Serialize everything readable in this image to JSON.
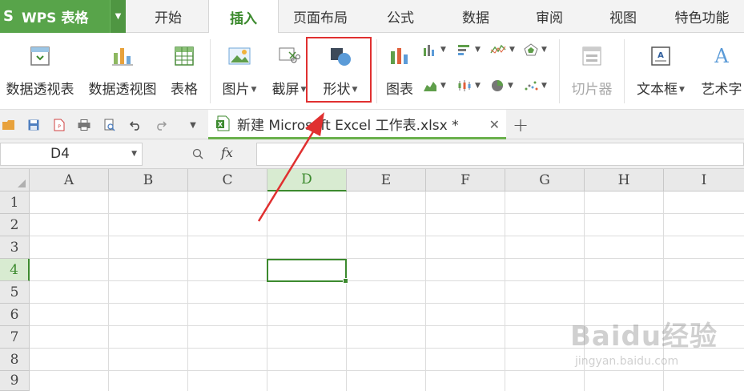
{
  "app": {
    "name": "WPS 表格",
    "logo_glyph": "ꓢ"
  },
  "menu": {
    "tabs": [
      "开始",
      "插入",
      "页面布局",
      "公式",
      "数据",
      "审阅",
      "视图",
      "特色功能"
    ],
    "active": "插入"
  },
  "ribbon": {
    "pivot_table": "数据透视表",
    "pivot_chart": "数据透视图",
    "table": "表格",
    "picture": "图片",
    "screenshot": "截屏",
    "shapes": "形状",
    "chart": "图表",
    "slicer": "切片器",
    "textbox": "文本框",
    "wordart": "艺术字"
  },
  "document": {
    "tab_title": "新建 Microsoft Excel 工作表.xlsx *"
  },
  "formula_bar": {
    "cell_ref": "D4",
    "fx_label": "fx",
    "formula": ""
  },
  "sheet": {
    "columns": [
      "A",
      "B",
      "C",
      "D",
      "E",
      "F",
      "G",
      "H",
      "I"
    ],
    "rows": [
      "1",
      "2",
      "3",
      "4",
      "5",
      "6",
      "7",
      "8",
      "9"
    ],
    "selected_column": "D",
    "selected_row": "4"
  },
  "watermark": {
    "brand": "Baidu经验",
    "url": "jingyan.baidu.com"
  },
  "colors": {
    "brand_green": "#58a44a",
    "accent_green": "#3c8a2e",
    "highlight_red": "#e03030"
  }
}
